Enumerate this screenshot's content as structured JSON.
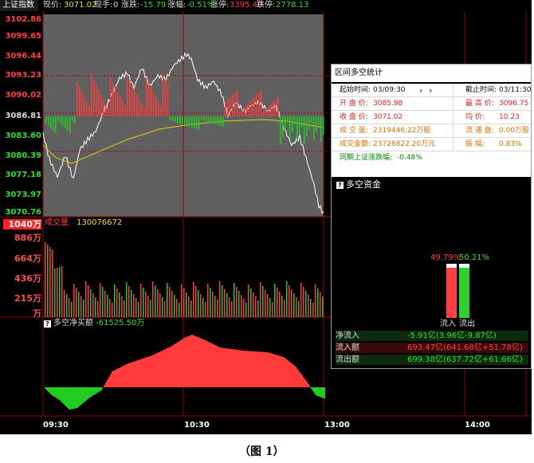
{
  "header": {
    "index_name": "上证指数",
    "price_label": "现价:",
    "price": "3071.02",
    "hand_label": "现手:",
    "hand": "0",
    "change_label": "涨跌:",
    "change": "-15.79",
    "pct_label": "涨幅:",
    "pct": "-0.51%",
    "limit_up_label": "涨停:",
    "limit_up": "3395.49",
    "limit_down_label": "跌停:",
    "limit_down": "2778.13"
  },
  "price_axis": [
    "3102.86",
    "3099.65",
    "3096.44",
    "3093.23",
    "3090.02",
    "3086.81",
    "3083.60",
    "3080.39",
    "3077.18",
    "3073.97",
    "3070.76"
  ],
  "volume_panel": {
    "label": "成交量",
    "value": "130076672",
    "axis_top": "1040万",
    "axis": [
      "886万",
      "664万",
      "436万",
      "215万",
      "万"
    ]
  },
  "netbuy_panel": {
    "label": "多空净买额",
    "value": "-61525.50万"
  },
  "time_axis": [
    "09:30",
    "10:30",
    "13:00",
    "14:00"
  ],
  "stats": {
    "title": "区间多空统计",
    "start_label": "起始时间:",
    "start": "03/09:30",
    "prev_icon": "‹",
    "next_icon": "›",
    "end_label": "截止时间:",
    "end": "03/11:30",
    "open_label": "开 盘 价:",
    "open": "3085.98",
    "high_label": "最 高 价:",
    "high": "3096.75",
    "close_label": "收 盘 价:",
    "close": "3071.02",
    "avg_label": "均    价:",
    "avg": "10.23",
    "vol_label": "成 交 量:",
    "vol": "2319446.22万股",
    "float_label": "流 通 盘:",
    "float": "0.00万股",
    "amount_label": "成交金额:",
    "amount": "23726822.20万元",
    "amp_label": "振    幅:",
    "amp": "0.83%",
    "period_label": "同期上证涨跌幅:",
    "period": "-0.48%"
  },
  "flow": {
    "title": "多空资金",
    "in_pct": "49.79%",
    "out_pct": "50.21%",
    "in_label": "流入",
    "out_label": "流出",
    "net_label": "净流入",
    "net": "-5.91亿(3.96亿-9.87亿)",
    "inflow_label": "流入额",
    "inflow": "693.47亿(641.68亿+51.78亿)",
    "outflow_label": "流出额",
    "outflow": "699.38亿(637.72亿+61.66亿)"
  },
  "caption": "（图 1）",
  "colors": {
    "up": "#ff3b3b",
    "down": "#22cc22",
    "avg_line": "#e0d000",
    "price_line": "#ffffff",
    "grid": "#9a0000"
  }
}
